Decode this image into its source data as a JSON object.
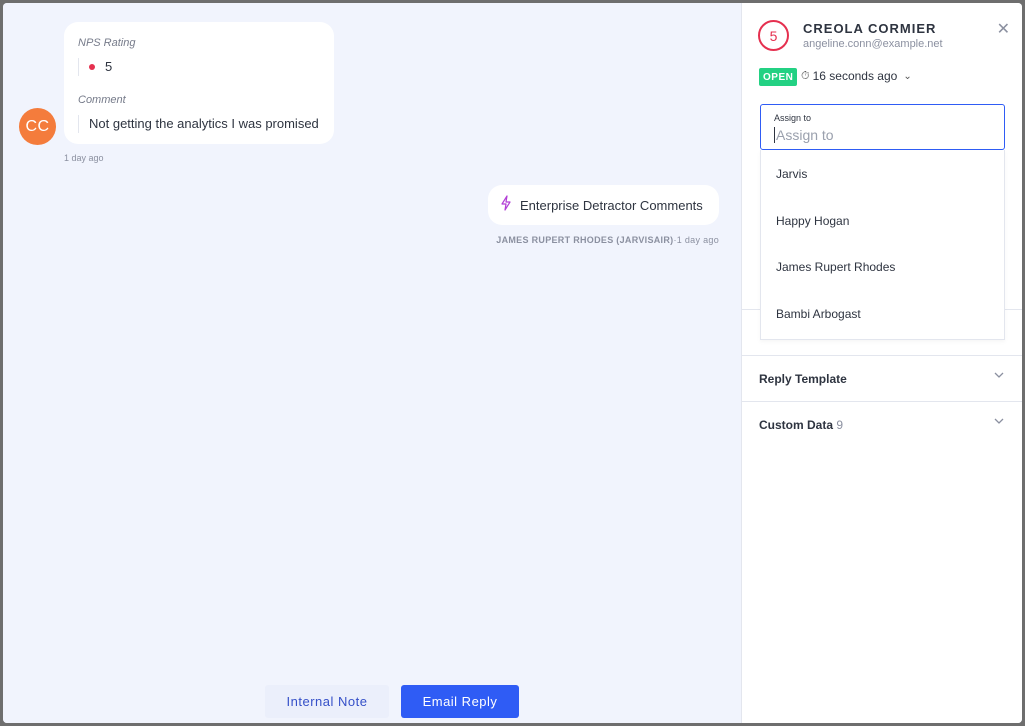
{
  "conversation": {
    "avatar_initials": "CC",
    "incoming": {
      "nps_label": "NPS Rating",
      "nps_value": "5",
      "comment_label": "Comment",
      "comment_value": "Not getting the analytics I was promised",
      "time": "1 day ago"
    },
    "outgoing": {
      "text": "Enterprise Detractor Comments",
      "author": "JAMES RUPERT RHODES (JARVISAIR)",
      "separator": "·",
      "time": "1 day ago"
    },
    "buttons": {
      "internal_note": "Internal Note",
      "email_reply": "Email Reply"
    }
  },
  "panel": {
    "score": "5",
    "customer_name": "CREOLA CORMIER",
    "customer_email": "angeline.conn@example.net",
    "status_badge": "OPEN",
    "status_time": "16 seconds ago",
    "assign": {
      "label": "Assign to",
      "placeholder": "Assign to",
      "options": [
        "Jarvis",
        "Happy Hogan",
        "James Rupert Rhodes",
        "Bambi Arbogast"
      ]
    },
    "sections": {
      "reply_template": "Reply Template",
      "custom_data": "Custom Data",
      "custom_data_count": "9"
    }
  },
  "colors": {
    "accent": "#2f5cf5",
    "open_badge": "#23d183",
    "detractor": "#e5304f",
    "avatar": "#f47c3c"
  },
  "icons": {
    "lightning": "lightning-icon",
    "clock": "clock-icon",
    "close": "close-icon",
    "chevron": "chevron-down-icon"
  }
}
